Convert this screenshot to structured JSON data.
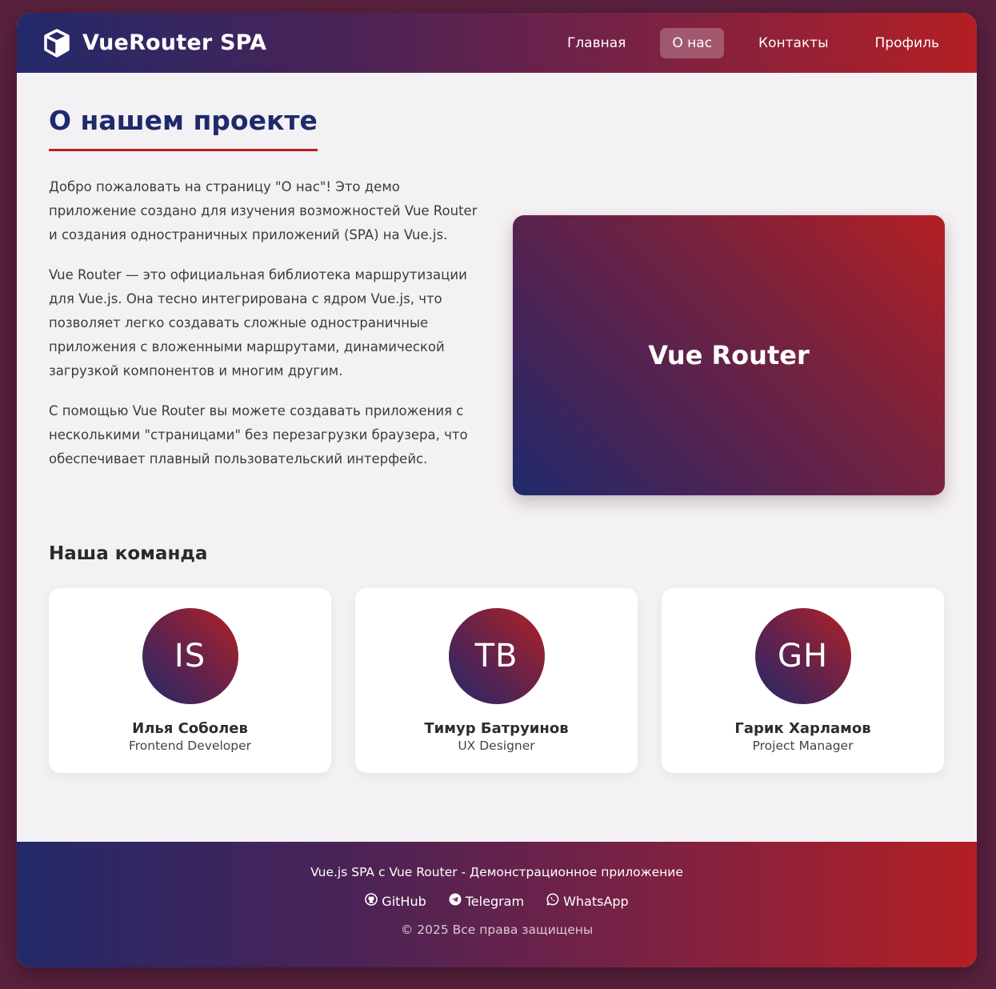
{
  "header": {
    "brand": "VueRouter SPA",
    "logo_icon": "cube-icon",
    "nav": [
      {
        "label": "Главная",
        "active": false
      },
      {
        "label": "О нас",
        "active": true
      },
      {
        "label": "Контакты",
        "active": false
      },
      {
        "label": "Профиль",
        "active": false
      }
    ]
  },
  "main": {
    "title": "О нашем проекте",
    "paragraphs": [
      "Добро пожаловать на страницу \"О нас\"! Это демо приложение создано для изучения возможностей Vue Router и создания одностраничных приложений (SPA) на Vue.js.",
      "Vue Router — это официальная библиотека маршрутизации для Vue.js. Она тесно интегрирована с ядром Vue.js, что позволяет легко создавать сложные одностраничные приложения с вложенными маршрутами, динамической загрузкой компонентов и многим другим.",
      "С помощью Vue Router вы можете создавать приложения с несколькими \"страницами\" без перезагрузки браузера, что обеспечивает плавный пользовательский интерфейс."
    ],
    "visual_label": "Vue Router"
  },
  "team": {
    "title": "Наша команда",
    "members": [
      {
        "initials": "IS",
        "name": "Илья Соболев",
        "role": "Frontend Developer"
      },
      {
        "initials": "TB",
        "name": "Тимур Батруинов",
        "role": "UX Designer"
      },
      {
        "initials": "GH",
        "name": "Гарик Харламов",
        "role": "Project Manager"
      }
    ]
  },
  "footer": {
    "tagline": "Vue.js SPA с Vue Router - Демонстрационное приложение",
    "links": [
      {
        "label": "GitHub",
        "icon": "github-icon"
      },
      {
        "label": "Telegram",
        "icon": "telegram-icon"
      },
      {
        "label": "WhatsApp",
        "icon": "whatsapp-icon"
      }
    ],
    "copyright": "© 2025 Все права защищены"
  },
  "colors": {
    "primary_dark": "#1e2a6b",
    "accent_red": "#b31f24",
    "page_bg": "#5a213f",
    "content_bg": "#f4f1f4"
  }
}
